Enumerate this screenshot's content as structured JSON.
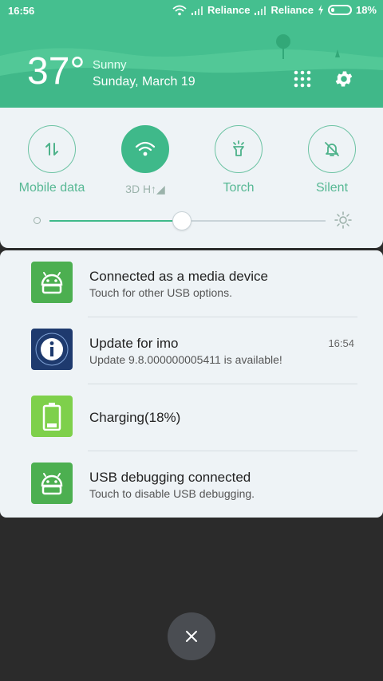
{
  "status_bar": {
    "time": "16:56",
    "carrier1": "Reliance",
    "carrier2": "Reliance",
    "battery_percent": "18%"
  },
  "weather": {
    "temperature": "37°",
    "condition": "Sunny",
    "date": "Sunday, March 19"
  },
  "quick_settings": {
    "toggles": [
      {
        "label": "Mobile data",
        "icon": "data-arrows-icon",
        "active": false
      },
      {
        "label": "3D   H↑◢",
        "icon": "wifi-icon",
        "active": true
      },
      {
        "label": "Torch",
        "icon": "flashlight-icon",
        "active": false
      },
      {
        "label": "Silent",
        "icon": "bell-off-icon",
        "active": false
      }
    ],
    "brightness_level": 0.48
  },
  "notifications": [
    {
      "title": "Connected as a media device",
      "subtitle": "Touch for other USB options.",
      "time": "",
      "icon": "android-icon"
    },
    {
      "title": "Update for imo",
      "subtitle": "Update 9.8.000000005411 is available!",
      "time": "16:54",
      "icon": "imo-info-icon"
    },
    {
      "title": "Charging(18%)",
      "subtitle": "",
      "time": "",
      "icon": "battery-icon"
    },
    {
      "title": "USB debugging connected",
      "subtitle": "Touch to disable USB debugging.",
      "time": "",
      "icon": "android-icon"
    }
  ],
  "colors": {
    "accent": "#3fb98a",
    "panel": "#eef3f6",
    "dark_bg": "#2b2b2b"
  }
}
